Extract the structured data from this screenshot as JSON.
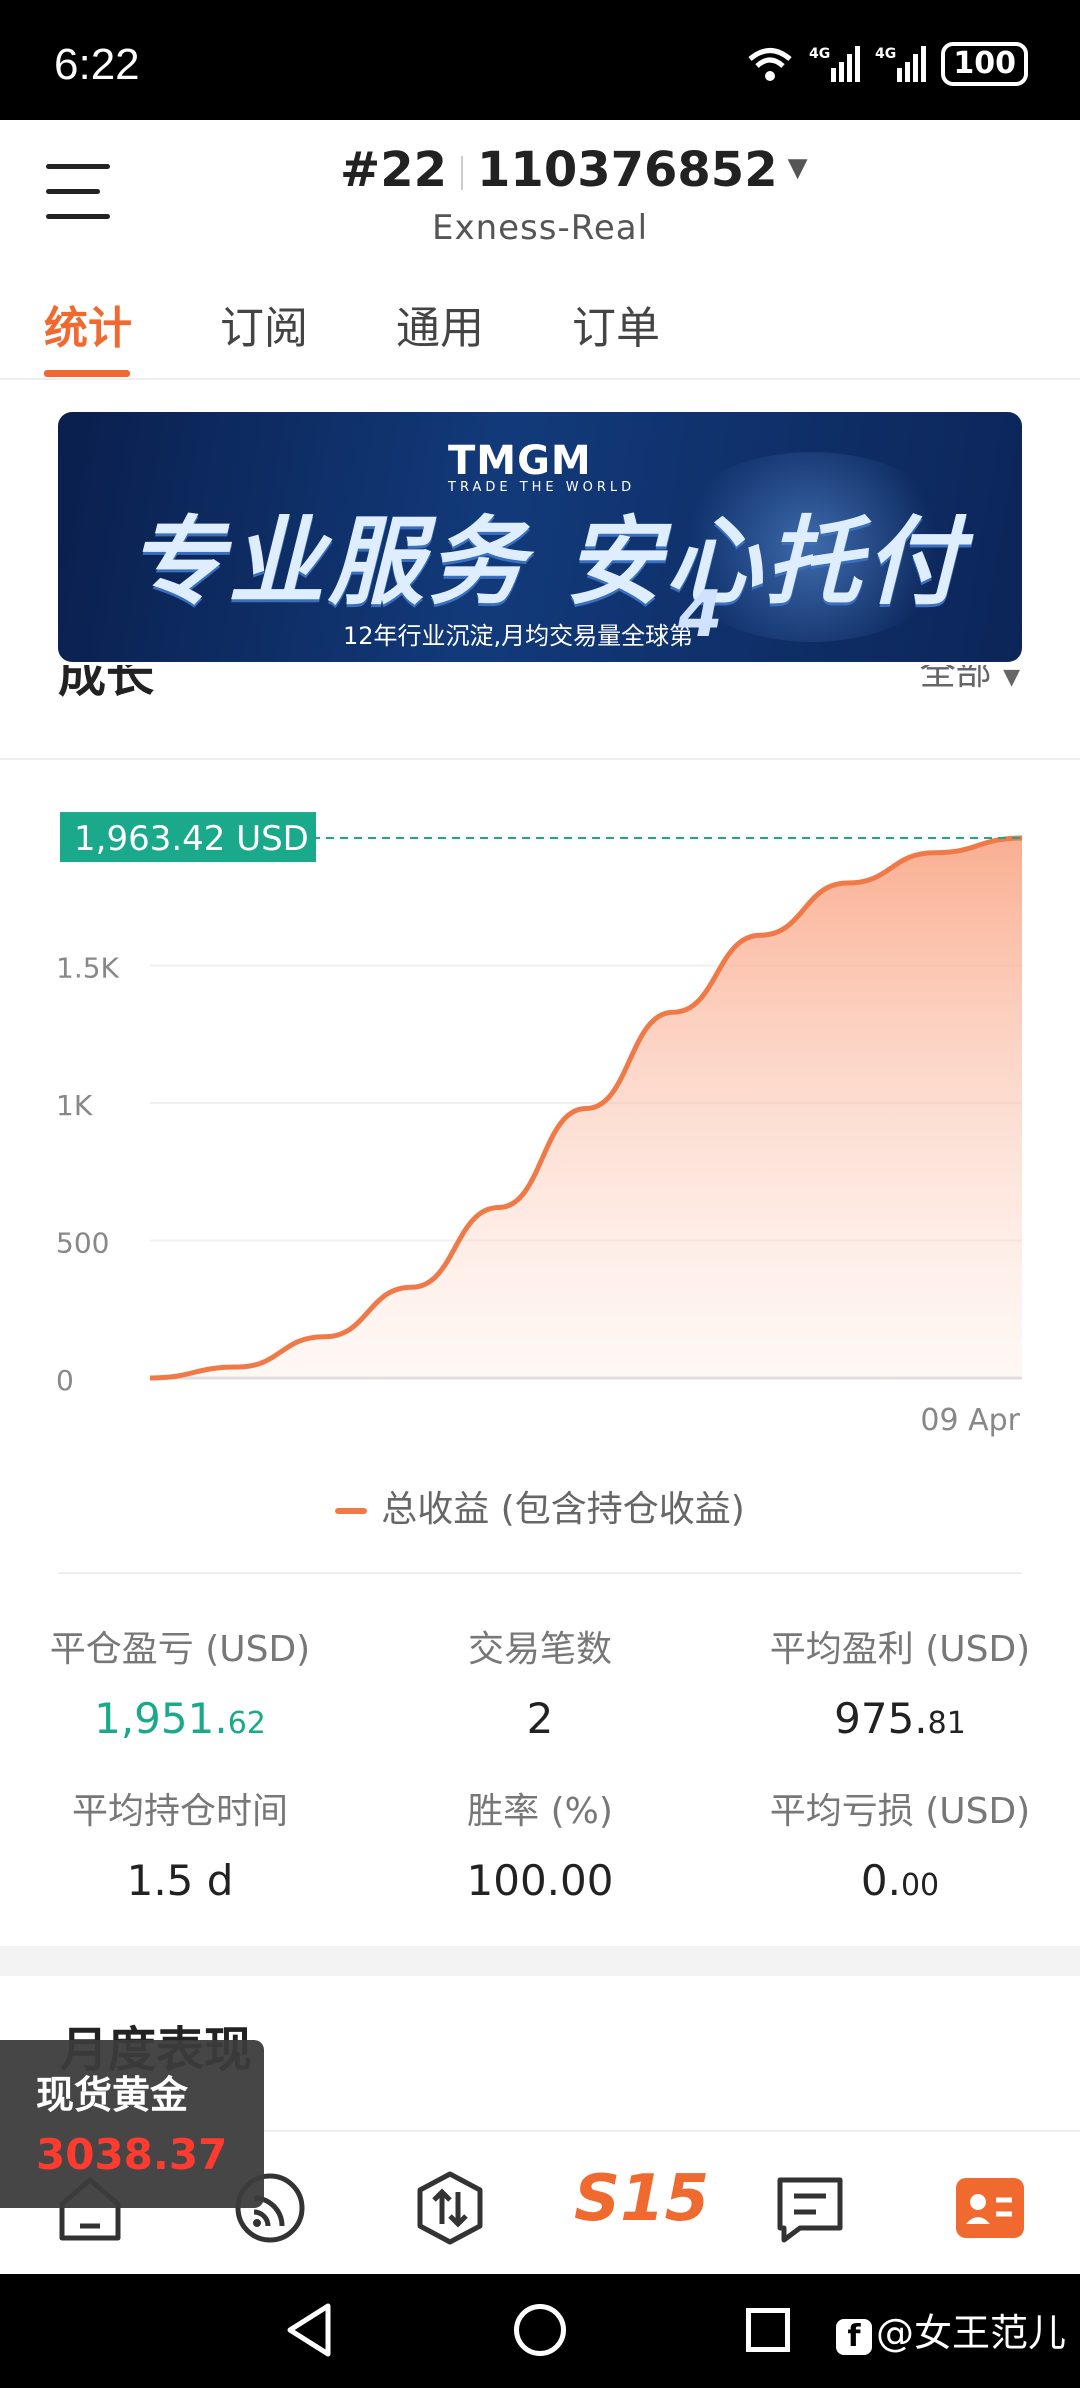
{
  "status_bar": {
    "time": "6:22",
    "network": "4G 4G",
    "battery": "100"
  },
  "header": {
    "account_num": "#22",
    "account_id": "110376852",
    "server": "Exness-Real"
  },
  "tabs": [
    {
      "label": "统计",
      "active": true
    },
    {
      "label": "订阅",
      "active": false
    },
    {
      "label": "通用",
      "active": false
    },
    {
      "label": "订单",
      "active": false
    }
  ],
  "banner": {
    "logo": "TMGM",
    "logo_tagline": "TRADE THE WORLD",
    "headline": "专业服务 安心托付",
    "subline": "12年行业沉淀,月均交易量全球第",
    "rank": "4"
  },
  "growth": {
    "title": "成长",
    "filter": "全部"
  },
  "chart_data": {
    "type": "area",
    "y_ticks": [
      "0",
      "500",
      "1K",
      "1.5K"
    ],
    "ylim": [
      0,
      2000
    ],
    "x_label_end": "09 Apr",
    "current_value_label": "1,963.42 USD",
    "series": [
      {
        "name": "总收益 (包含持仓收益)",
        "color": "#ef7a48",
        "x": [
          0,
          0.1,
          0.2,
          0.3,
          0.4,
          0.5,
          0.6,
          0.7,
          0.8,
          0.9,
          1.0
        ],
        "values": [
          0,
          40,
          150,
          330,
          620,
          980,
          1330,
          1610,
          1800,
          1910,
          1963.42
        ]
      }
    ]
  },
  "stats": [
    {
      "label": "平仓盈亏 (USD)",
      "value_main": "1,951.",
      "value_dec": "62",
      "color": "green"
    },
    {
      "label": "交易笔数",
      "value_main": "2",
      "value_dec": ""
    },
    {
      "label": "平均盈利 (USD)",
      "value_main": "975.",
      "value_dec": "81"
    },
    {
      "label": "平均持仓时间",
      "value_main": "1.5 d",
      "value_dec": ""
    },
    {
      "label": "胜率 (%)",
      "value_main": "100.00",
      "value_dec": ""
    },
    {
      "label": "平均亏损 (USD)",
      "value_main": "0.",
      "value_dec": "00"
    }
  ],
  "monthly": {
    "title": "月度表现"
  },
  "gold_widget": {
    "name": "现货黄金",
    "price": "3038.37"
  },
  "bottom_nav": [
    "home-icon",
    "feed-icon",
    "trade-icon",
    "s15-logo",
    "message-icon",
    "profile-icon"
  ],
  "bottom_nav_logo": "S15",
  "watermark": "@女王范儿",
  "colors": {
    "accent": "#f06a30",
    "green": "#1aa98b",
    "price_red": "#ff3b30"
  }
}
